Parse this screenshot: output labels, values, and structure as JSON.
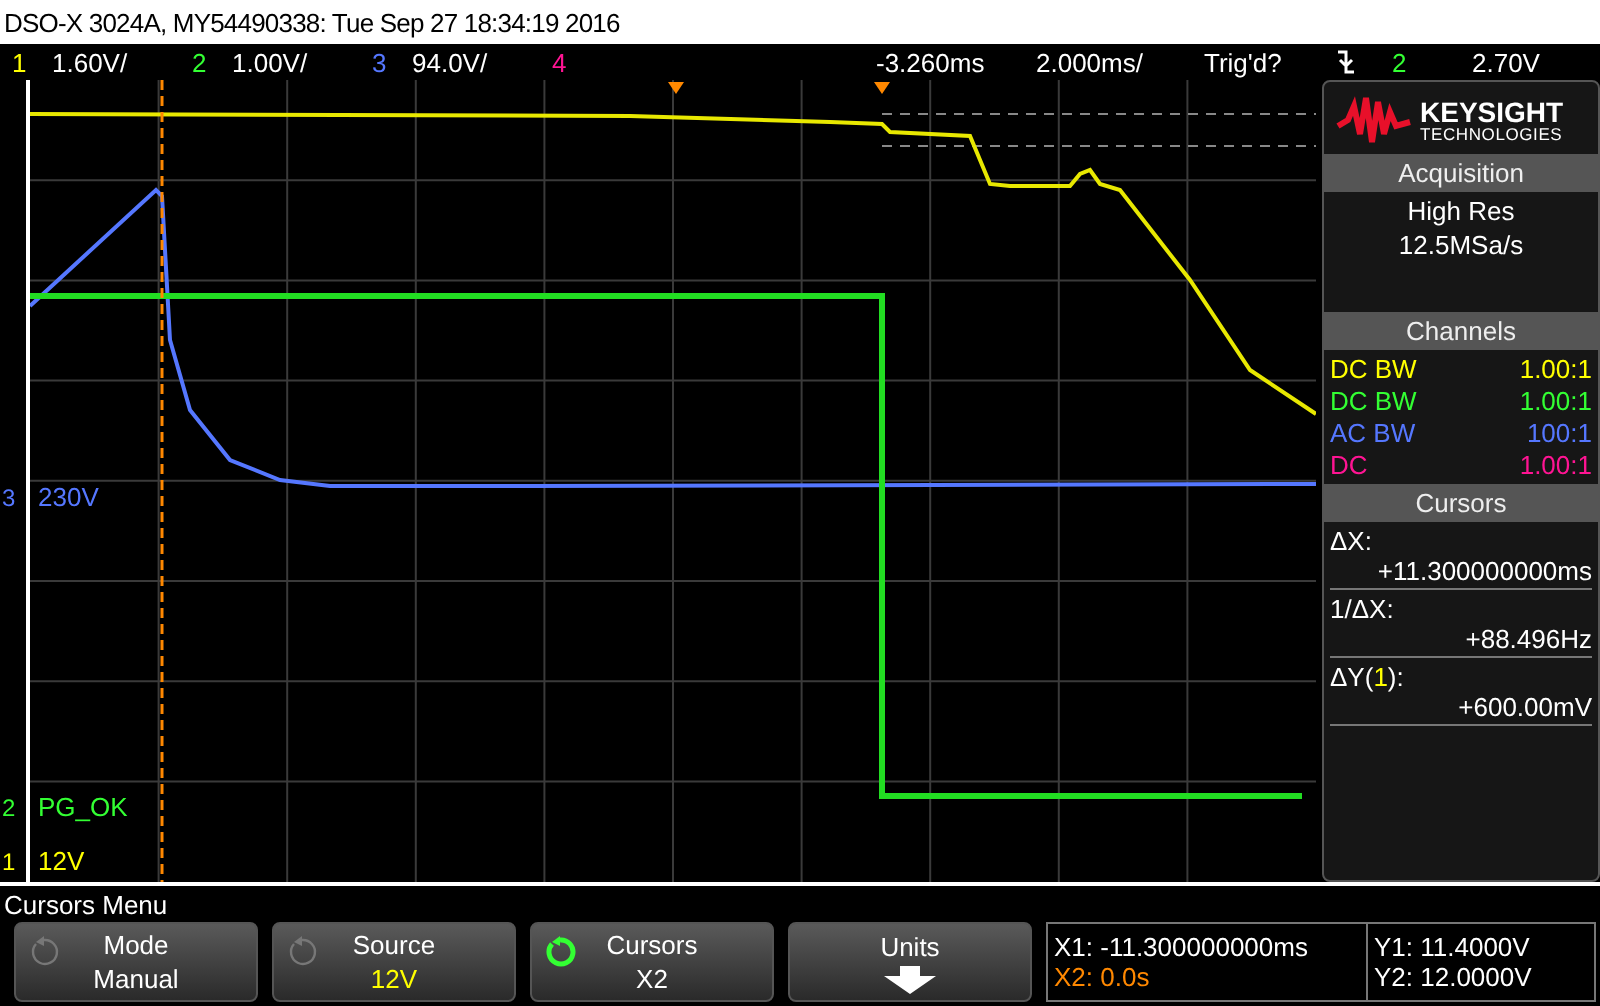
{
  "window": {
    "title": "DSO-X 3024A, MY54490338: Tue Sep 27 18:34:19 2016"
  },
  "status": {
    "channels": [
      {
        "number": "1",
        "scale": "1.60V/",
        "color": "#ffff00"
      },
      {
        "number": "2",
        "scale": "1.00V/",
        "color": "#33ff33"
      },
      {
        "number": "3",
        "scale": "94.0V/",
        "color": "#5577ff"
      },
      {
        "number": "4",
        "color": "#ff1493"
      }
    ],
    "delay": "-3.260ms",
    "timebase": "2.000ms/",
    "trigger_status": "Trig'd?",
    "trigger_source": {
      "text": "2",
      "color": "#33ff33"
    },
    "trigger_level": "2.70V"
  },
  "trace_labels": [
    {
      "number": "3",
      "label": "230V",
      "color": "#5577ff"
    },
    {
      "number": "2",
      "label": "PG_OK",
      "color": "#33ff33"
    },
    {
      "number": "1",
      "label": "12V",
      "color": "#ffff00"
    }
  ],
  "side_panel": {
    "logo": {
      "name": "KEYSIGHT",
      "subtitle": "TECHNOLOGIES"
    },
    "acquisition": {
      "title": "Acquisition",
      "lines": [
        "High Res",
        "12.5MSa/s"
      ]
    },
    "channels": {
      "title": "Channels",
      "rows": [
        {
          "coupling": "DC BW",
          "probe": "1.00:1",
          "color": "#ffff00"
        },
        {
          "coupling": "DC BW",
          "probe": "1.00:1",
          "color": "#33ff33"
        },
        {
          "coupling": "AC BW",
          "probe": "100:1",
          "color": "#5577ff"
        },
        {
          "coupling": "DC",
          "probe": "1.00:1",
          "color": "#ff1493"
        }
      ]
    },
    "cursors": {
      "title": "Cursors",
      "entries": [
        {
          "label": "ΔX:",
          "value": "+11.300000000ms"
        },
        {
          "label": "1/ΔX:",
          "value": "+88.496Hz"
        },
        {
          "label": "ΔY(",
          "label_channel": {
            "text": "1",
            "color": "#ffff00"
          },
          "label_end": "):",
          "value": "+600.00mV"
        }
      ]
    }
  },
  "menu": {
    "title": "Cursors Menu",
    "softkeys": [
      {
        "kind": "rotary",
        "title": "Mode",
        "value": "Manual"
      },
      {
        "kind": "rotary",
        "title": "Source",
        "value": "12V",
        "color": "#ffff00"
      },
      {
        "kind": "rotary-active",
        "title": "Cursors",
        "value": "X2"
      },
      {
        "kind": "arrow",
        "title": "Units"
      }
    ],
    "readouts": [
      {
        "text": "X1: -11.300000000ms",
        "selected": false
      },
      {
        "text": "X2: 0.0s",
        "selected": true
      },
      {
        "text": "Y1: 11.4000V",
        "selected": false
      },
      {
        "text": "Y2: 12.0000V",
        "selected": false
      }
    ]
  }
}
